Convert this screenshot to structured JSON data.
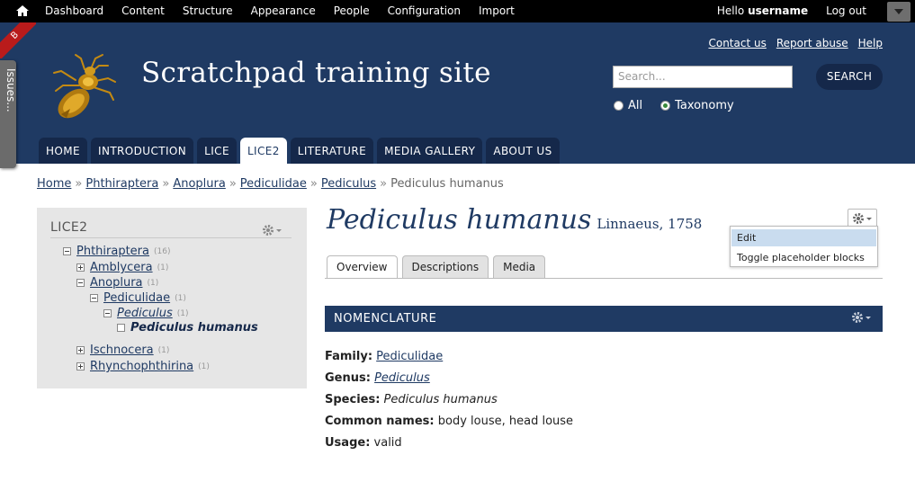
{
  "toolbar": {
    "menu": [
      "Dashboard",
      "Content",
      "Structure",
      "Appearance",
      "People",
      "Configuration",
      "Import"
    ],
    "hello": "Hello",
    "username": "username",
    "logout": "Log out"
  },
  "header": {
    "ribbon": "B",
    "issues_tab": "Issues...",
    "site_name": "Scratchpad training site",
    "secondary_links": [
      "Contact us",
      "Report abuse",
      "Help"
    ],
    "search_placeholder": "Search...",
    "search_button": "SEARCH",
    "search_scope": {
      "options": [
        "All",
        "Taxonomy"
      ],
      "selected": "Taxonomy"
    },
    "tabs": [
      "HOME",
      "INTRODUCTION",
      "LICE",
      "LICE2",
      "LITERATURE",
      "MEDIA GALLERY",
      "ABOUT US"
    ],
    "active_tab": "LICE2"
  },
  "breadcrumb": {
    "links": [
      "Home",
      "Phthiraptera",
      "Anoplura",
      "Pediculidae",
      "Pediculus"
    ],
    "current": "Pediculus humanus",
    "separator": "»"
  },
  "sidebar": {
    "title": "LICE2",
    "tree": [
      {
        "label": "Phthiraptera",
        "count": "(16)",
        "state": "expanded"
      },
      {
        "label": "Amblycera",
        "count": "(1)",
        "state": "collapsed"
      },
      {
        "label": "Anoplura",
        "count": "(1)",
        "state": "expanded"
      },
      {
        "label": "Pediculidae",
        "count": "(1)",
        "state": "expanded"
      },
      {
        "label": "Pediculus",
        "count": "(1)",
        "state": "expanded"
      },
      {
        "label": "Pediculus humanus",
        "count": "",
        "state": "leaf"
      },
      {
        "label": "Ischnocera",
        "count": "(1)",
        "state": "collapsed"
      },
      {
        "label": "Rhynchophthirina",
        "count": "(1)",
        "state": "collapsed"
      }
    ]
  },
  "main": {
    "title": "Pediculus humanus",
    "author": "Linnaeus, 1758",
    "context_menu": [
      "Edit",
      "Toggle placeholder blocks"
    ],
    "tabs": [
      "Overview",
      "Descriptions",
      "Media"
    ],
    "active_tab": "Overview",
    "section_title": "NOMENCLATURE",
    "fields": {
      "family": {
        "label": "Family:",
        "value": "Pediculidae"
      },
      "genus": {
        "label": "Genus:",
        "value": "Pediculus"
      },
      "species": {
        "label": "Species:",
        "value": "Pediculus humanus"
      },
      "common": {
        "label": "Common names:",
        "value": "body louse, head louse"
      },
      "usage": {
        "label": "Usage:",
        "value": "valid"
      }
    }
  },
  "colors": {
    "header_bg": "#1f3a63",
    "tab_bg": "#15284a",
    "toolbar_bg": "#000000",
    "sidebar_bg": "#e6e6e6",
    "ribbon": "#b91b1b"
  }
}
